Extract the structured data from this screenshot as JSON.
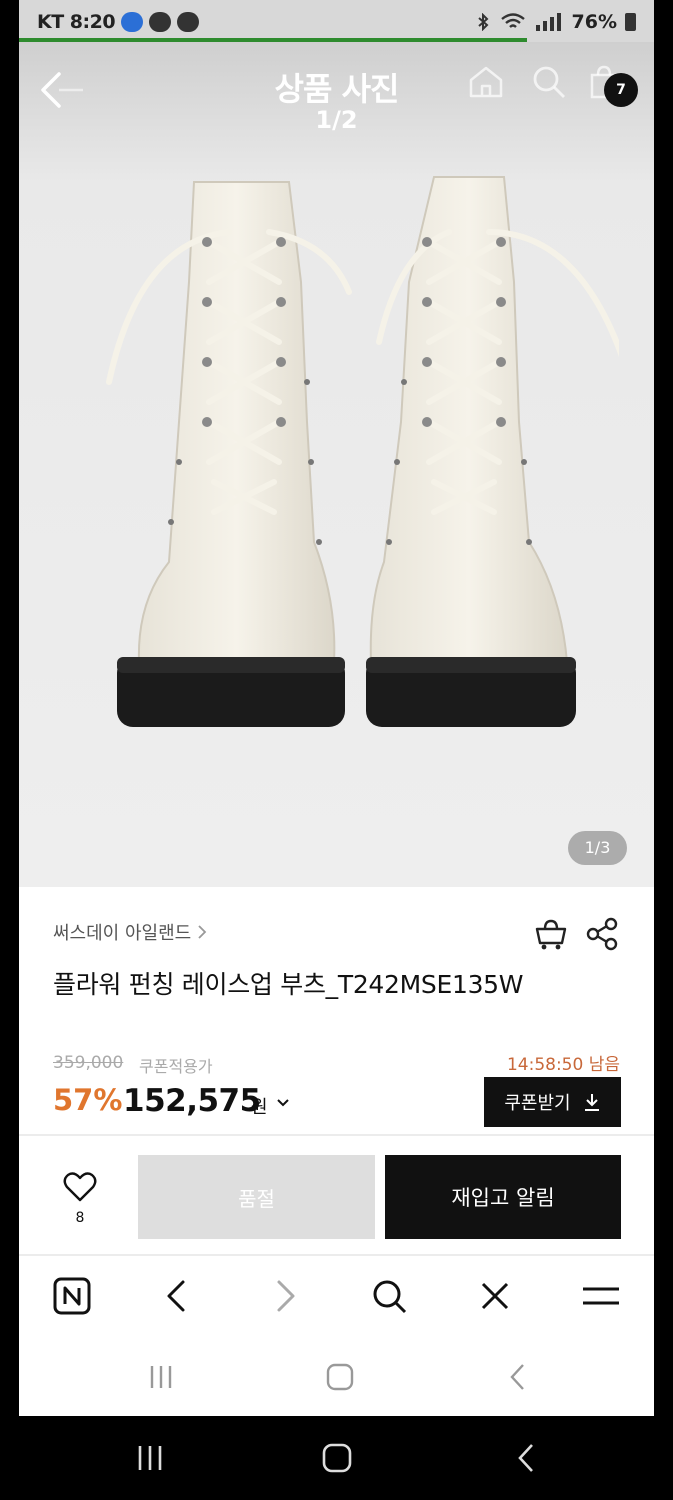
{
  "status_bar": {
    "carrier_time": "KT 8:20",
    "battery": "76%"
  },
  "page_load_progress": 0.8,
  "header": {
    "title": "상품 사진",
    "photo_index": "1/2",
    "cart_count": "7"
  },
  "gallery": {
    "counter": "1/3"
  },
  "product": {
    "brand": "써스데이 아일랜드",
    "name": "플라워 펀칭 레이스업 부츠_T242MSE135W",
    "original_price": "359,000",
    "coupon_note": "쿠폰적용가",
    "timer": "14:58:50 남음",
    "discount": "57%",
    "price": "152,575",
    "currency": "원",
    "coupon_button": "쿠폰받기"
  },
  "actions": {
    "like_count": "8",
    "soldout_label": "품절",
    "restock_label": "재입고 알림"
  },
  "icons": {
    "back": "back-arrow-icon",
    "home": "home-icon",
    "search": "search-icon",
    "bag": "shopping-bag-icon",
    "cart_add": "cart-icon",
    "share": "share-icon",
    "heart": "heart-icon",
    "naver": "naver-icon",
    "prev": "chevron-left-icon",
    "next": "chevron-right-icon",
    "close": "close-icon",
    "menu": "menu-icon"
  },
  "colors": {
    "accent": "#e0762e",
    "timer": "#c8683a",
    "primary_button": "#111111",
    "disabled_button": "#dedede",
    "progress": "#2e8b2e"
  }
}
